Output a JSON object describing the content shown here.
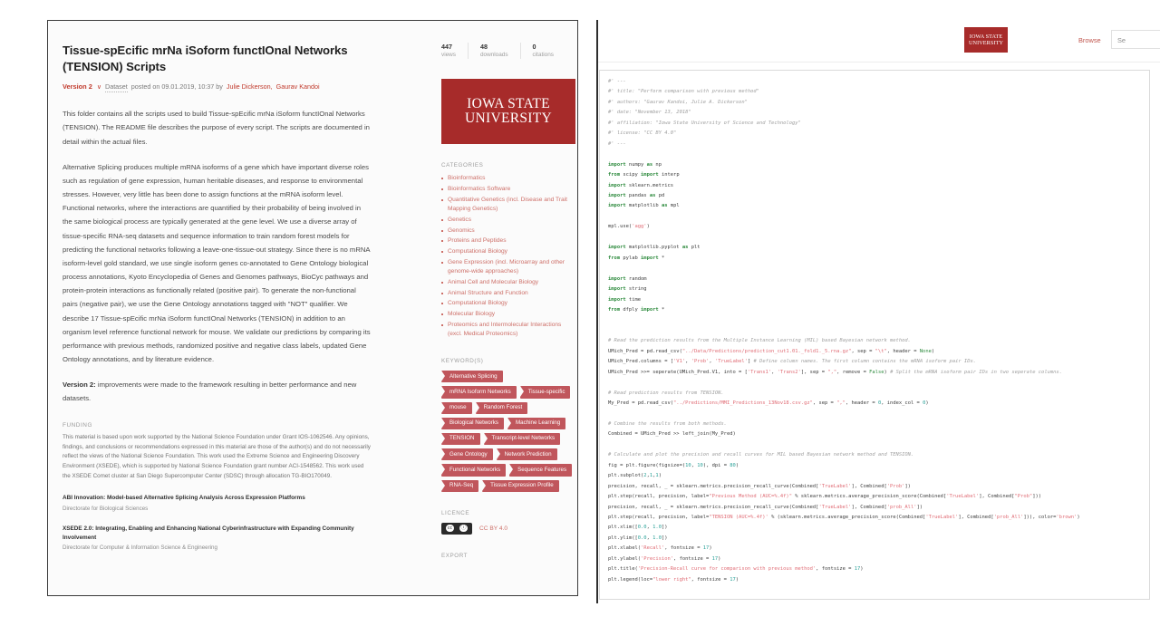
{
  "left_window": {
    "article": {
      "title": "Tissue-spEcific mrNa iSoform functIOnal Networks (TENSION) Scripts",
      "version_label": "Version 2",
      "chevron": "∨",
      "dataset_label": "Dataset",
      "posted_text": "posted on 09.01.2019, 10:37 by",
      "authors": [
        "Julie Dickerson,",
        "Gaurav Kandoi"
      ],
      "paragraphs": [
        "This folder contains all the scripts used to build Tissue-spEcific mrNa iSoform functIOnal Networks (TENSION). The README file describes the purpose of every script. The scripts are documented in detail within the actual files.",
        "Alternative Splicing produces multiple mRNA isoforms of a gene which have important diverse roles such as regulation of gene expression, human heritable diseases, and response to environmental stresses. However, very little has been done to assign functions at the mRNA isoform level. Functional networks, where the interactions are quantified by their probability of being involved in the same biological process are typically generated at the gene level. We use a diverse array of tissue-specific RNA-seq datasets and sequence information to train random forest models for predicting the functional networks following a leave-one-tissue-out strategy. Since there is no mRNA isoform-level gold standard, we use single isoform genes co-annotated to Gene Ontology biological process annotations, Kyoto Encyclopedia of Genes and Genomes pathways, BioCyc pathways and protein-protein interactions as functionally related (positive pair). To generate the non-functional pairs (negative pair), we use the Gene Ontology annotations tagged with \"NOT\" qualifier. We describe 17 Tissue-spEcific mrNa iSoform functIOnal Networks (TENSION) in addition to an organism level reference functional network for mouse. We validate our predictions by comparing its performance with previous methods, randomized positive and negative class labels, updated Gene Ontology annotations, and by literature evidence."
      ],
      "version_note_bold": "Version 2:",
      "version_note_rest": " improvements were made to the framework resulting in better performance and new datasets."
    },
    "funding": {
      "label": "FUNDING",
      "text": "This material is based upon work supported by the National Science Foundation under Grant IOS-1062546. Any opinions, findings, and conclusions or recommendations expressed in this material are those of the author(s) and do not necessarily reflect the views of the National Science Foundation. This work used the Extreme Science and Engineering Discovery Environment (XSEDE), which is supported by National Science Foundation grant number ACI-1548562. This work used the XSEDE Comet cluster at San Diego Supercomputer Center (SDSC) through allocation TG-BIO170049.",
      "grants": [
        {
          "title": "ABI Innovation: Model-based Alternative Splicing Analysis Across Expression Platforms",
          "subtitle": "Directorate for Biological Sciences"
        },
        {
          "title": "XSEDE 2.0: Integrating, Enabling and Enhancing National Cyberinfrastructure with Expanding Community Involvement",
          "subtitle": "Directorate for Computer & Information Science & Engineering"
        }
      ]
    },
    "stats": [
      {
        "num": "447",
        "label": "views"
      },
      {
        "num": "48",
        "label": "downloads"
      },
      {
        "num": "0",
        "label": "citations"
      }
    ],
    "logo": {
      "line1": "Iowa State",
      "line2": "University"
    },
    "categories_label": "CATEGORIES",
    "categories": [
      "Bioinformatics",
      "Bioinformatics Software",
      "Quantitative Genetics (incl. Disease and Trait Mapping Genetics)",
      "Genetics",
      "Genomics",
      "Proteins and Peptides",
      "Computational Biology",
      "Gene Expression (incl. Microarray and other genome-wide approaches)",
      "Animal Cell and Molecular Biology",
      "Animal Structure and Function",
      "Computational Biology",
      "Molecular Biology",
      "Proteomics and Intermolecular Interactions (excl. Medical Proteomics)"
    ],
    "keywords_label": "KEYWORD(S)",
    "keywords": [
      "Alternative Splicing",
      "mRNA Isoform Networks",
      "Tissue-specific",
      "mouse",
      "Random Forest",
      "Biological Networks",
      "Machine Learning",
      "TENSION",
      "Transcript-level Networks",
      "Gene Ontology",
      "Network Prediction",
      "Functional Networks",
      "Sequence Features",
      "RNA-Seq",
      "Tissue Expression Profile"
    ],
    "licence_label": "LICENCE",
    "licence_value": "CC BY 4.0",
    "cc_glyph_1": "cc",
    "cc_glyph_2": "ⓘ",
    "export_label": "EXPORT"
  },
  "right_window": {
    "header": {
      "logo_line1": "Iowa State",
      "logo_line2": "University",
      "browse_label": "Browse",
      "search_placeholder": "Se"
    },
    "code_lines": [
      "#' ---",
      "#' title: \"Perform comparison with previous method\"",
      "#' authors: \"Gaurav Kandoi, Julie A. Dickerson\"",
      "#' date: \"November 13, 2018\"",
      "#' affiliation: \"Iowa State University of Science and Technology\"",
      "#' license: \"CC BY 4.0\"",
      "#' ---",
      "",
      "import numpy as np",
      "from scipy import interp",
      "import sklearn.metrics",
      "import pandas as pd",
      "import matplotlib as mpl",
      "",
      "mpl.use('agg')",
      "",
      "import matplotlib.pyplot as plt",
      "from pylab import *",
      "",
      "import random",
      "import string",
      "import time",
      "from dfply import *",
      "",
      "",
      "# Read the prediction results from the Multiple Instance Learning (MIL) based Bayesian network method.",
      "UMich_Pred = pd.read_csv(\"../Data/Predictions/prediction_cut1.01._fold1._5.rna.gz\", sep = \"\\t\", header = None)",
      "UMich_Pred.columns = ['V1', 'Prob', 'TrueLabel'] # Define column names. The first column contains the mRNA isoform pair IDs.",
      "UMich_Pred >>= seperate(UMich_Pred.V1, into = ['Trans1', 'Trans2'], sep = \",\", remove = False) # Split the mRNA isoform pair IDs in two seperate columns.",
      "",
      "# Read prediction results from TENSION.",
      "My_Pred = pd.read_csv(\"../Predictions/MMI_Predictions_13Nov18.csv.gz\", sep = \",\", header = 0, index_col = 0)",
      "",
      "# Combine the results from both methods.",
      "Combined = UMich_Pred >> left_join(My_Pred)",
      "",
      "# Calculate and plot the precision and recall curves for MIL based Bayesian network method and TENSION.",
      "fig = plt.figure(figsize=(10, 10), dpi = 80)",
      "plt.subplot(2,1,1)",
      "precision, recall, _ = sklearn.metrics.precision_recall_curve(Combined['TrueLabel'], Combined['Prob'])",
      "plt.step(recall, precision, label=\"Previous Method (AUC=%.4f)\" % sklearn.metrics.average_precision_score(Combined['TrueLabel'], Combined[\"Prob\"]))",
      "precision, recall, _ = sklearn.metrics.precision_recall_curve(Combined['TrueLabel'], Combined['prob_All'])",
      "plt.step(recall, precision, label=\"TENSION (AUC=%.4f)' % (sklearn.metrics.average_precision_score(Combined['TrueLabel'], Combined['prob_All'])), color='brown')",
      "plt.xlim([0.0, 1.0])",
      "plt.ylim([0.0, 1.0])",
      "plt.xlabel('Recall', fontsize = 17)",
      "plt.ylabel('Precision', fontsize = 17)",
      "plt.title('Precision-Recall curve for comparison with previous method', fontsize = 17)",
      "plt.legend(loc=\"lower right\", fontsize = 17)"
    ]
  }
}
